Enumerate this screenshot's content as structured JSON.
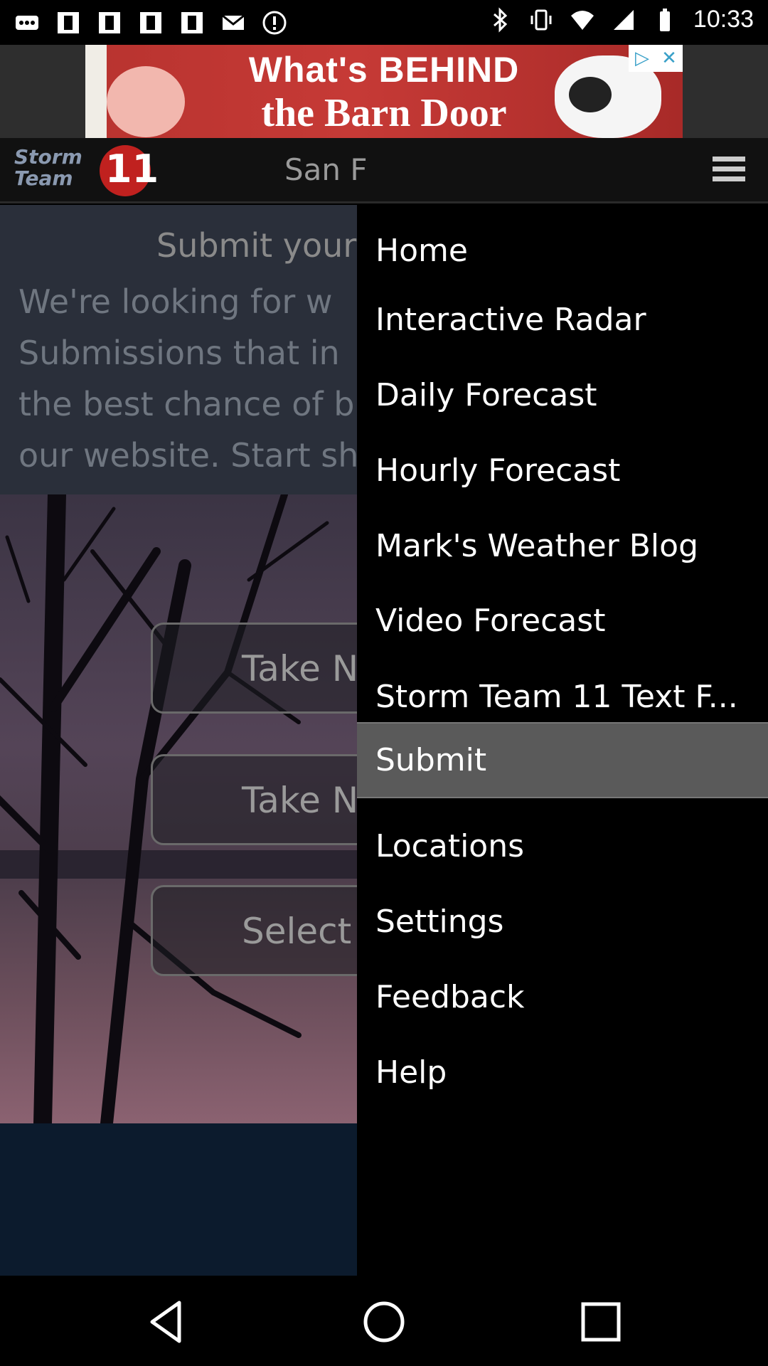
{
  "status_bar": {
    "time": "10:33",
    "left_icons": [
      "more-icon",
      "fantasy-app-icon",
      "fantasy-app-icon",
      "fantasy-app-icon",
      "fantasy-app-icon",
      "mail-icon",
      "alert-icon"
    ],
    "right_icons": [
      "bluetooth-icon",
      "vibrate-icon",
      "wifi-icon",
      "signal-icon",
      "battery-icon"
    ]
  },
  "ad": {
    "line1": "What's BEHIND",
    "line2": "the Barn Door",
    "play_badge": "▷",
    "close_badge": "✕"
  },
  "header": {
    "logo_text": "Storm Team",
    "logo_number": "11",
    "title": "San F"
  },
  "submit_section": {
    "heading": "Submit your",
    "body": "We're looking for w\nSubmissions that in\nthe best chance of b\nour website. Start sh"
  },
  "actions": [
    {
      "label": "Take N"
    },
    {
      "label": "Take N"
    },
    {
      "label": "Select fr"
    }
  ],
  "menu": {
    "items": [
      {
        "label": "Home"
      },
      {
        "label": "Interactive Radar"
      },
      {
        "label": "Daily Forecast"
      },
      {
        "label": "Hourly Forecast"
      },
      {
        "label": "Mark's Weather Blog"
      },
      {
        "label": "Video Forecast"
      },
      {
        "label": "Storm Team 11 Text F..."
      },
      {
        "label": "Submit"
      },
      {
        "label": "Locations"
      },
      {
        "label": "Settings"
      },
      {
        "label": "Feedback"
      },
      {
        "label": "Help"
      }
    ],
    "active": "Submit"
  },
  "nav_bar": {
    "icons": [
      "back-icon",
      "home-icon",
      "recents-icon"
    ]
  },
  "colors": {
    "drawer_bg": "#000000",
    "active_item_bg": "#5a5a5a",
    "logo_red": "#c0211f"
  }
}
